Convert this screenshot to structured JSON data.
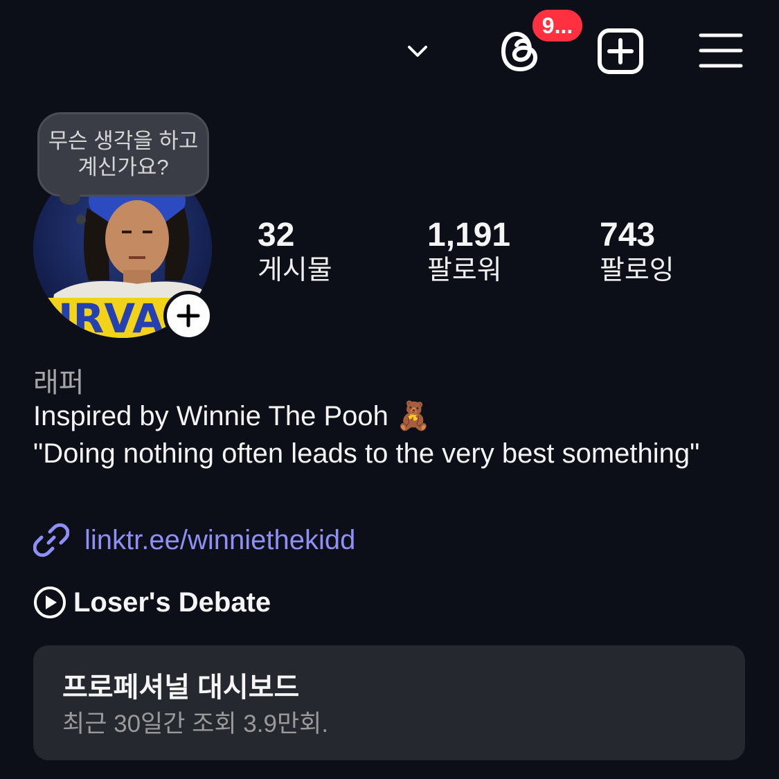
{
  "header": {
    "notification_count": "9..."
  },
  "profile": {
    "note": "무슨 생각을 하고 계신가요?",
    "stats": [
      {
        "value": "32",
        "label": "게시물"
      },
      {
        "value": "1,191",
        "label": "팔로워"
      },
      {
        "value": "743",
        "label": "팔로잉"
      }
    ],
    "category": "래퍼",
    "bio": "Inspired by Winnie The Pooh 🧸\n\"Doing nothing often leads to the very best something\"",
    "link": "linktr.ee/winniethekidd",
    "music": "Loser's Debate",
    "avatar_text": "IRVA"
  },
  "dashboard": {
    "title": "프로페셔널 대시보드",
    "subtitle": "최근 30일간 조회 3.9만회."
  },
  "colors": {
    "background": "#0c0f17",
    "badge": "#ff3040",
    "link": "#8f8ff5",
    "card": "#262830"
  }
}
